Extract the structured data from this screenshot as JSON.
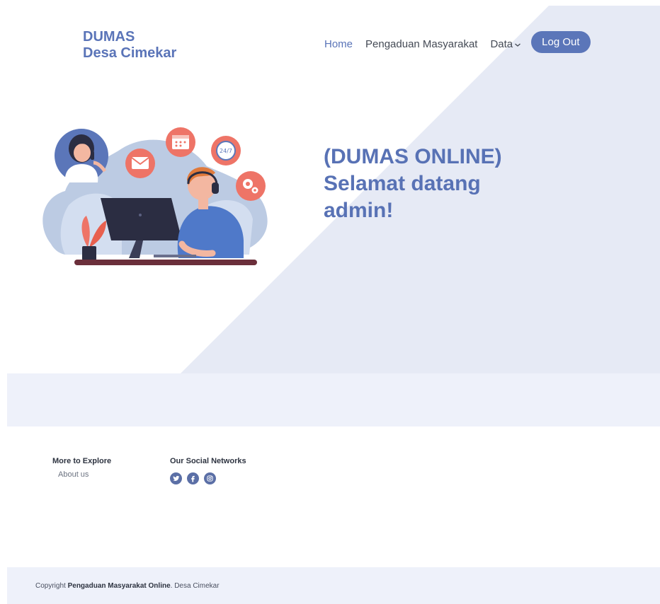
{
  "brand": {
    "line1": "DUMAS",
    "line2": "Desa Cimekar",
    "color": "#5a74b8"
  },
  "nav": {
    "home": "Home",
    "complaints": "Pengaduan Masyarakat",
    "data": "Data",
    "logout": "Log Out"
  },
  "hero": {
    "line1": "(DUMAS ONLINE)",
    "line2": "Selamat datang",
    "line3": "admin!",
    "color": "#5872b5",
    "illustration_icons": [
      "mail-icon",
      "calendar-icon",
      "clock-24-7-icon",
      "gear-icon",
      "headset-icon"
    ]
  },
  "footer": {
    "explore_title": "More to Explore",
    "about_link": "About us",
    "social_title": "Our Social Networks",
    "social_icons": [
      "twitter-icon",
      "facebook-icon",
      "instagram-icon"
    ]
  },
  "copyright": {
    "prefix": "Copyright",
    "bold": "Pengaduan Masyarakat Online",
    "suffix": ". Desa Cimekar"
  }
}
